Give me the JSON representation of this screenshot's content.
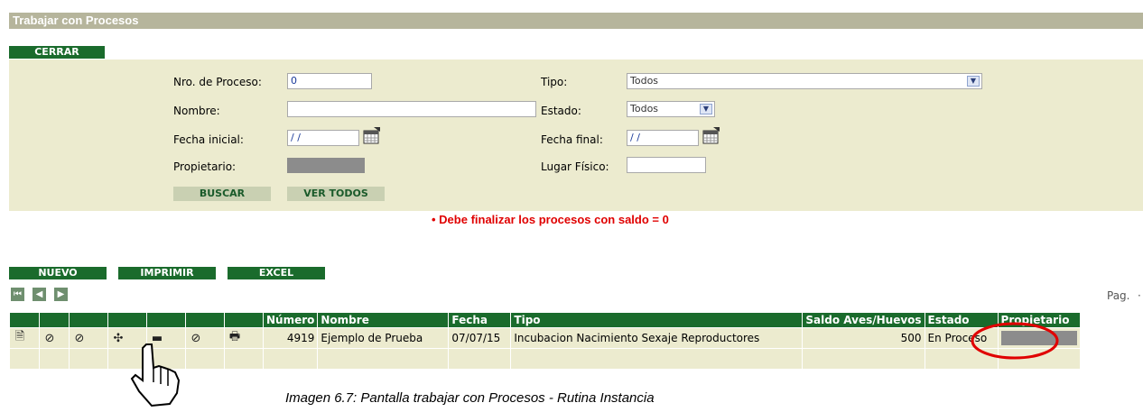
{
  "window": {
    "title": "Trabajar con Procesos"
  },
  "toolbar": {
    "cerrar": "CERRAR"
  },
  "filters": {
    "nro_label": "Nro. de Proceso:",
    "nro_value": "0",
    "nombre_label": "Nombre:",
    "nombre_value": "",
    "fecha_ini_label": "Fecha inicial:",
    "fecha_ini_value": "/ /",
    "propietario_label": "Propietario:",
    "tipo_label": "Tipo:",
    "tipo_value": "Todos",
    "estado_label": "Estado:",
    "estado_value": "Todos",
    "fecha_fin_label": "Fecha final:",
    "fecha_fin_value": "/ /",
    "lugar_label": "Lugar Físico:",
    "lugar_value": "",
    "buscar": "BUSCAR",
    "ver_todos": "VER TODOS"
  },
  "warning": "Debe finalizar los procesos con saldo = 0",
  "actions": {
    "nuevo": "NUEVO",
    "imprimir": "IMPRIMIR",
    "excel": "EXCEL"
  },
  "pagination": {
    "label": "Pag."
  },
  "table": {
    "headers": [
      "Número",
      "Nombre",
      "Fecha",
      "Tipo",
      "Saldo Aves/Huevos",
      "Estado",
      "Propietario"
    ],
    "rows": [
      {
        "numero": "4919",
        "nombre": "Ejemplo de Prueba",
        "fecha": "07/07/15",
        "tipo": "Incubacion Nacimiento Sexaje Reproductores",
        "saldo": "500",
        "estado": "En Proceso"
      }
    ]
  },
  "caption": "Imagen 6.7: Pantalla trabajar con Procesos - Rutina Instancia",
  "colors": {
    "header_green": "#1a6b2c",
    "panel_bg": "#ecebcf",
    "title_bg": "#b6b59c",
    "warning_red": "#e00000",
    "highlight_circle": "#e00000"
  },
  "icons": [
    "doc-icon",
    "cancel-icon",
    "cancel-icon",
    "expand-icon",
    "collapse-icon",
    "cancel-icon",
    "print-icon",
    "hand-cursor-icon"
  ]
}
